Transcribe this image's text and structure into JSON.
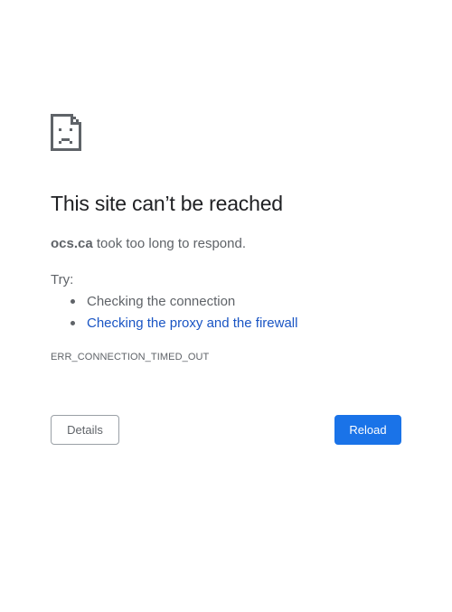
{
  "error": {
    "icon": "sad-page-icon",
    "title": "This site can’t be reached",
    "host": "ocs.ca",
    "summary_suffix": " took too long to respond.",
    "try_label": "Try:",
    "suggestions": [
      {
        "text": "Checking the connection",
        "is_link": false
      },
      {
        "text": "Checking the proxy and the firewall",
        "is_link": true
      }
    ],
    "code": "ERR_CONNECTION_TIMED_OUT"
  },
  "buttons": {
    "details_label": "Details",
    "reload_label": "Reload"
  },
  "colors": {
    "title": "#202124",
    "body_text": "#5f6368",
    "link": "#1a55c4",
    "primary_button": "#1a73e8",
    "secondary_border": "#9aa0a6"
  }
}
